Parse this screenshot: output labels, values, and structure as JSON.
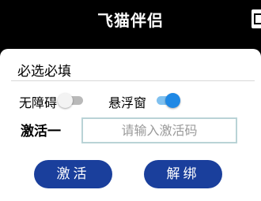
{
  "app": {
    "title": "飞猫伴侣"
  },
  "card": {
    "section_title": "必选必填",
    "options": [
      {
        "label": "无障碍",
        "enabled": false
      },
      {
        "label": "悬浮窗",
        "enabled": true
      }
    ],
    "activation": {
      "label": "激活一",
      "input_value": "",
      "input_placeholder": "请输入激活码"
    },
    "buttons": {
      "activate_label": "激活",
      "unbind_label": "解绑"
    }
  },
  "colors": {
    "background": "#000000",
    "button_bg": "#1a3f9c",
    "toggle_on": "#1f88e5",
    "input_border": "#b9d3d6"
  }
}
